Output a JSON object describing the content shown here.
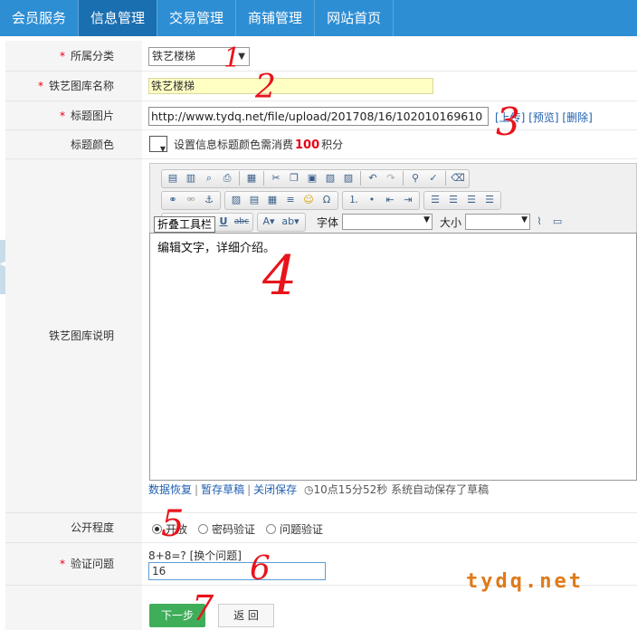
{
  "nav": {
    "items": [
      "会员服务",
      "信息管理",
      "交易管理",
      "商铺管理",
      "网站首页"
    ],
    "active_index": 1
  },
  "form": {
    "category": {
      "label": "所属分类",
      "value": "铁艺楼梯"
    },
    "gallery_name": {
      "label": "铁艺图库名称",
      "value": "铁艺楼梯"
    },
    "title_image": {
      "label": "标题图片",
      "value": "http://www.tydq.net/file/upload/201708/16/102010169610",
      "upload": "[上传]",
      "preview": "[预览]",
      "delete": "[删除]"
    },
    "title_color": {
      "label": "标题颜色",
      "text_before": "设置信息标题颜色需消费",
      "points": "100",
      "text_after": "积分"
    },
    "description": {
      "label": "铁艺图库说明",
      "content": "编辑文字，详细介绍。",
      "toolbar": {
        "tooltip": "折叠工具栏",
        "font_label": "字体",
        "size_label": "大小"
      }
    },
    "draft_bar": {
      "restore": "数据恢复",
      "save_draft": "暂存草稿",
      "close_save": "关闭保存",
      "status": "10点15分52秒 系统自动保存了草稿"
    },
    "visibility": {
      "label": "公开程度",
      "options": [
        "开放",
        "密码验证",
        "问题验证"
      ],
      "selected_index": 0
    },
    "verification": {
      "label": "验证问题",
      "question": "8+8=?",
      "change": "[换个问题]",
      "answer": "16"
    },
    "buttons": {
      "next": "下一步",
      "back": "返 回"
    }
  },
  "watermark": "tydq.net",
  "annotations": [
    "1",
    "2",
    "3",
    "4",
    "5",
    "6",
    "7"
  ],
  "colors": {
    "nav_bg": "#2e8ed4",
    "nav_active": "#1a6fb1",
    "required": "#e60012",
    "next_btn": "#3fae5a",
    "annotation": "#e8141b",
    "watermark": "#e07a18"
  }
}
